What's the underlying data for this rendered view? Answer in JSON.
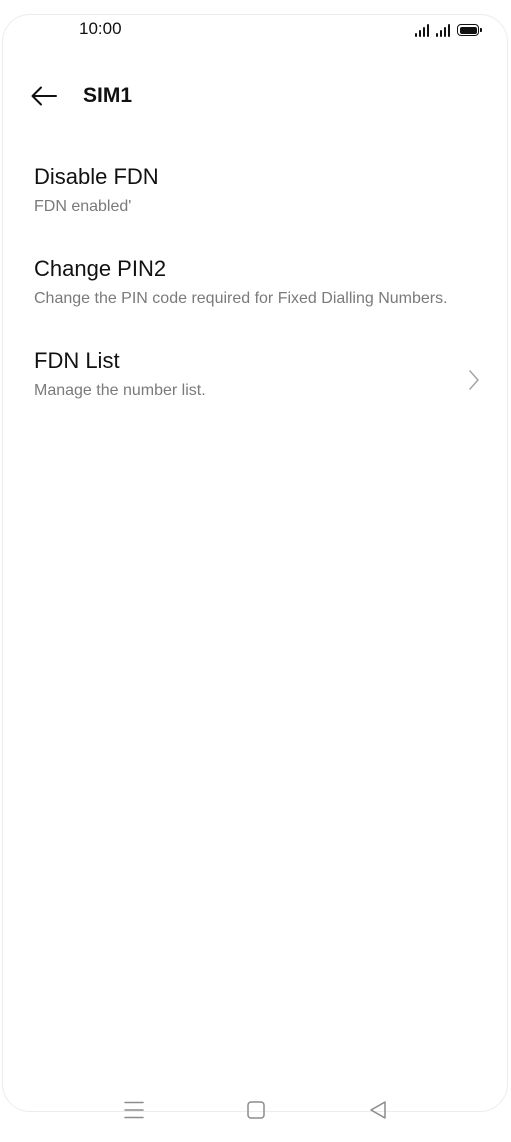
{
  "status_bar": {
    "time": "10:00",
    "icons": [
      "signal-sim1-icon",
      "signal-sim2-icon",
      "battery-icon"
    ]
  },
  "toolbar": {
    "title": "SIM1",
    "back_icon": "back-arrow-icon"
  },
  "settings": [
    {
      "title": "Disable FDN",
      "summary": "FDN enabled'"
    },
    {
      "title": "Change PIN2",
      "summary": "Change the PIN code required for Fixed Dialling Numbers."
    },
    {
      "title": "FDN List",
      "summary": "Manage the number list.",
      "icon": "chevron-right-icon"
    }
  ],
  "nav_bar": {
    "icons": [
      "menu-icon",
      "home-icon",
      "back-icon"
    ]
  },
  "colors": {
    "text_primary": "#111111",
    "text_secondary": "#7a7a7a",
    "icon_muted": "#9a9a9a",
    "background": "#ffffff"
  }
}
